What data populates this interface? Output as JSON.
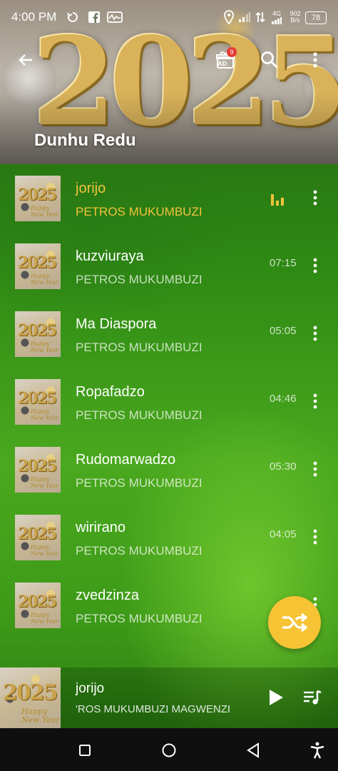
{
  "status_bar": {
    "time": "4:00 PM",
    "network_type": "4G",
    "data_rate_value": "902",
    "data_rate_unit": "B/s",
    "battery": "78",
    "icons": [
      "sync-icon",
      "facebook-icon",
      "activity-icon",
      "location-icon",
      "signal-icon",
      "data-arrows-icon",
      "signal-4g-icon"
    ]
  },
  "app_bar": {
    "title": "Dunhu Redu",
    "ad_badge_count": "9",
    "ad_label": "AD",
    "header_art_text": "2025"
  },
  "songs": [
    {
      "title": "jorijo",
      "artist": "PETROS MUKUMBUZI",
      "duration": "",
      "playing": true
    },
    {
      "title": "kuzviuraya",
      "artist": "PETROS MUKUMBUZI",
      "duration": "07:15",
      "playing": false
    },
    {
      "title": "Ma Diaspora",
      "artist": "PETROS MUKUMBUZI",
      "duration": "05:05",
      "playing": false
    },
    {
      "title": "Ropafadzo",
      "artist": "PETROS MUKUMBUZI",
      "duration": "04:46",
      "playing": false
    },
    {
      "title": "Rudomarwadzo",
      "artist": "PETROS MUKUMBUZI",
      "duration": "05:30",
      "playing": false
    },
    {
      "title": "wirirano",
      "artist": "PETROS MUKUMBUZI",
      "duration": "04:05",
      "playing": false
    },
    {
      "title": "zvedzinza",
      "artist": "PETROS MUKUMBUZI",
      "duration": "",
      "playing": false
    }
  ],
  "thumb_art": {
    "year": "2025",
    "greeting_line1": "Happy",
    "greeting_line2": "New Year"
  },
  "now_playing": {
    "title": "jorijo",
    "artist": "'ROS MUKUMBUZI MAGWENZI"
  },
  "colors": {
    "accent": "#f2c33c",
    "fab": "#f6c335",
    "nav_bar": "#0f0f0f",
    "background_green": "#2f8a14"
  }
}
